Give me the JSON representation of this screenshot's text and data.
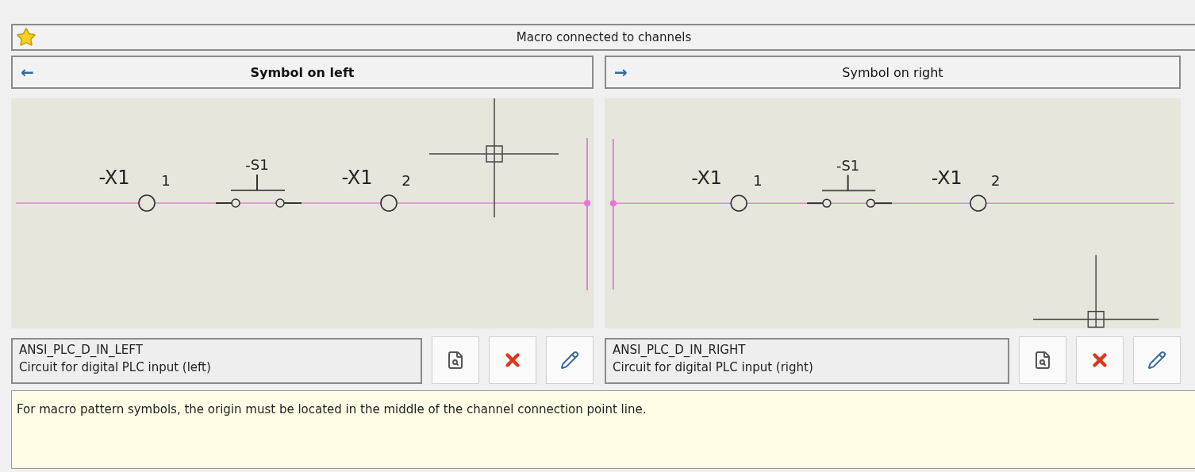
{
  "header": {
    "title": "Macro connected to channels"
  },
  "panels": [
    {
      "heading": "Symbol on left",
      "arrow": "←",
      "selected": true,
      "kind": "left",
      "labels": {
        "terminal_1": "-X1",
        "pin_1": "1",
        "switch": "-S1",
        "terminal_2": "-X1",
        "pin_2": "2"
      },
      "macro": {
        "name": "ANSI_PLC_D_IN_LEFT",
        "description": "Circuit for digital PLC input (left)"
      }
    },
    {
      "heading": "Symbol on right",
      "arrow": "→",
      "selected": false,
      "kind": "right",
      "labels": {
        "terminal_1": "-X1",
        "pin_1": "1",
        "switch": "-S1",
        "terminal_2": "-X1",
        "pin_2": "2"
      },
      "macro": {
        "name": "ANSI_PLC_D_IN_RIGHT",
        "description": "Circuit for digital PLC input (right)"
      }
    }
  ],
  "info": "For macro pattern symbols, the origin must be located in the middle of the channel connection point line."
}
